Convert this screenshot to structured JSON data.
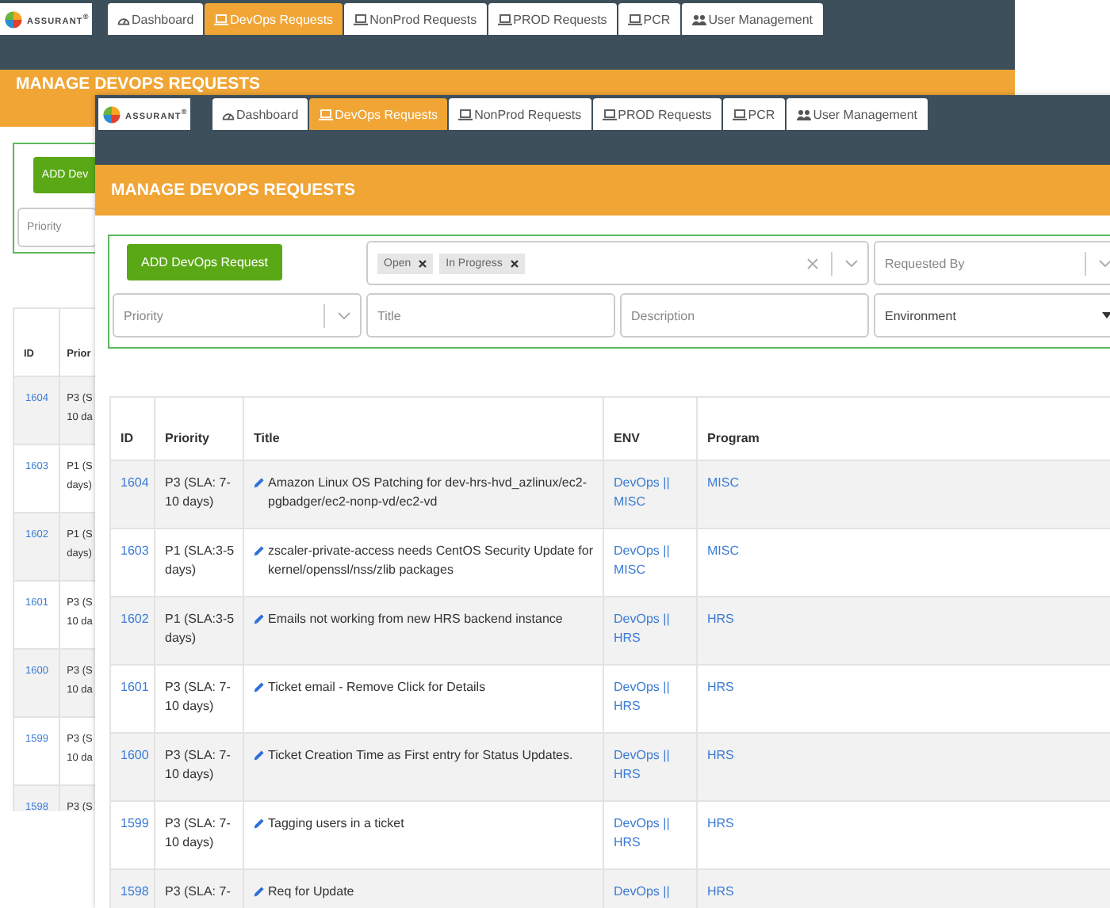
{
  "back_window": {
    "logo": "ASSURANT$^{®}$",
    "tabs": [
      {
        "label": "Dashboard",
        "selected": false
      },
      {
        "label": "DevOps Requests",
        "selected": true
      },
      {
        "label": "NonProd Requests",
        "selected": false
      },
      {
        "label": "PROD Requests",
        "selected": false
      },
      {
        "label": "PCR",
        "selected": false
      },
      {
        "label": "User Management",
        "selected": false
      }
    ],
    "page_title": "MANAGE DEVOPS REQUESTS",
    "add_button": "ADD Dev",
    "filters": {
      "priority": {
        "placeholder": "Priority"
      }
    },
    "table": {
      "columns": [
        "ID",
        "Prior"
      ],
      "rows": [
        {
          "id": "1604",
          "priority": "P3 (S\n10 da"
        },
        {
          "id": "1603",
          "priority": "P1 (S\ndays)"
        },
        {
          "id": "1602",
          "priority": "P1 (S\ndays)"
        },
        {
          "id": "1601",
          "priority": "P3 (S\n10 da"
        },
        {
          "id": "1600",
          "priority": "P3 (S\n10 da"
        },
        {
          "id": "1599",
          "priority": "P3 (S\n10 da"
        },
        {
          "id": "1598",
          "priority": "P3 (S"
        }
      ]
    }
  },
  "front_window": {
    "logo": "ASSURANT$^{®}$",
    "tabs": [
      {
        "label": "Dashboard",
        "selected": false
      },
      {
        "label": "DevOps Requests",
        "selected": true
      },
      {
        "label": "NonProd Requests",
        "selected": false
      },
      {
        "label": "PROD Requests",
        "selected": false
      },
      {
        "label": "PCR",
        "selected": false
      },
      {
        "label": "User Management",
        "selected": false
      }
    ],
    "page_title": "MANAGE DEVOPS REQUESTS",
    "add_button": "ADD DevOps Request",
    "filters": {
      "status": {
        "chips": [
          "Open",
          "In Progress"
        ]
      },
      "requested_by": {
        "placeholder": "Requested By"
      },
      "priority": {
        "placeholder": "Priority"
      },
      "title": {
        "placeholder": "Title"
      },
      "description": {
        "placeholder": "Description"
      },
      "environment": {
        "value": "Environment"
      }
    },
    "table": {
      "columns": [
        "ID",
        "Priority",
        "Title",
        "ENV",
        "Program"
      ],
      "rows": [
        {
          "id": "1604",
          "priority": "P3 (SLA: 7-10 days)",
          "title": "Amazon Linux OS Patching for dev-hrs-hvd_azlinux/ec2-pgbadger/ec2-nonp-vd/ec2-vd",
          "env": "DevOps || MISC",
          "program": "MISC"
        },
        {
          "id": "1603",
          "priority": "P1 (SLA:3-5 days)",
          "title": "zscaler-private-access needs CentOS Security Update for kernel/openssl/nss/zlib packages",
          "env": "DevOps || MISC",
          "program": "MISC"
        },
        {
          "id": "1602",
          "priority": "P1 (SLA:3-5 days)",
          "title": "Emails not working from new HRS backend instance",
          "env": "DevOps || HRS",
          "program": "HRS"
        },
        {
          "id": "1601",
          "priority": "P3 (SLA: 7-10 days)",
          "title": "Ticket email - Remove Click for Details",
          "env": "DevOps || HRS",
          "program": "HRS"
        },
        {
          "id": "1600",
          "priority": "P3 (SLA: 7-10 days)",
          "title": "Ticket Creation Time as First entry for Status Updates.",
          "env": "DevOps || HRS",
          "program": "HRS"
        },
        {
          "id": "1599",
          "priority": "P3 (SLA: 7-10 days)",
          "title": "Tagging users in a ticket",
          "env": "DevOps || HRS",
          "program": "HRS"
        },
        {
          "id": "1598",
          "priority": "P3 (SLA: 7-",
          "title": "Req for Update",
          "env": "DevOps ||",
          "program": "HRS"
        }
      ]
    }
  }
}
